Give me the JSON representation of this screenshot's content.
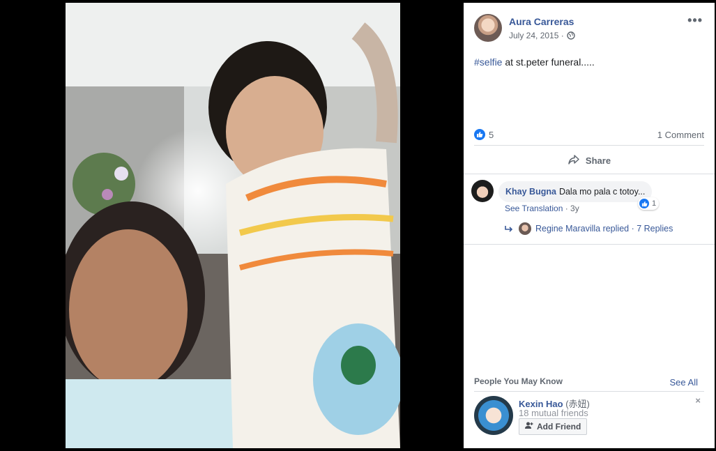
{
  "post": {
    "author": "Aura Carreras",
    "date": "July 24, 2015 ·",
    "privacy_icon": "globe-icon",
    "more_label": "•••",
    "hashtag": "#selfie",
    "text": " at st.peter funeral....."
  },
  "reactions": {
    "like_count": "5",
    "comments_label": "1 Comment"
  },
  "actions": {
    "share_label": "Share"
  },
  "comment": {
    "author": "Khay Bugna",
    "text": "Dala mo pala c totoy...",
    "like_count": "1",
    "see_translation": "See Translation",
    "age": " · 3y",
    "replies_label": "Regine Maravilla replied · 7 Replies"
  },
  "people_you_may_know": {
    "title": "People You May Know",
    "see_all": "See All",
    "person": {
      "name": "Kexin Hao",
      "name_cjk": "(赤妞)",
      "mutual": "18 mutual friends",
      "add_friend_label": "Add Friend",
      "close_label": "×"
    }
  },
  "colors": {
    "link": "#385898",
    "like_blue": "#1877f2",
    "background": "#000000"
  }
}
